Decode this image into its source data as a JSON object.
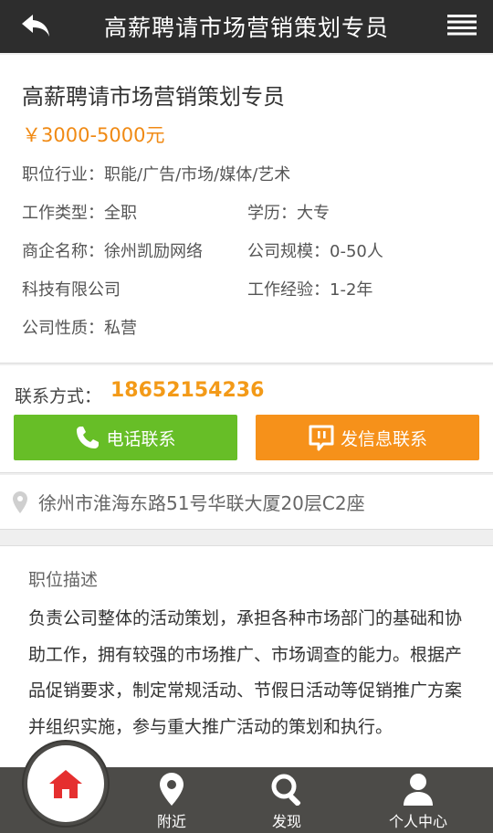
{
  "header": {
    "title": "高薪聘请市场营销策划专员",
    "back_icon": "back-arrow-icon",
    "menu_icon": "menu-icon"
  },
  "job": {
    "title": "高薪聘请市场营销策划专员",
    "salary": "￥3000-5000元",
    "industry": "职位行业：职能/广告/市场/媒体/艺术",
    "work_type": "工作类型：全职",
    "education": "学历：大专",
    "company_name_line1": "商企名称：徐州凯励网络",
    "company_name_line2": "科技有限公司",
    "company_size": "公司规模：0-50人",
    "experience": "工作经验：1-2年",
    "company_nature": "公司性质：私营"
  },
  "contact": {
    "label": "联系方式：",
    "phone": "18652154236",
    "call_button": "电话联系",
    "message_button": "发信息联系"
  },
  "address": {
    "text": "徐州市淮海东路51号华联大厦20层C2座"
  },
  "description": {
    "heading": "职位描述",
    "body": "负责公司整体的活动策划，承担各种市场部门的基础和协助工作，拥有较强的市场推广、市场调查的能力。根据产品促销要求，制定常规活动、节假日活动等促销推广方案并组织实施，参与重大推广活动的策划和执行。"
  },
  "bottom_nav": {
    "items": [
      {
        "label": "",
        "icon": "home-icon"
      },
      {
        "label": "附近",
        "icon": "location-pin-icon"
      },
      {
        "label": "发现",
        "icon": "search-icon"
      },
      {
        "label": "个人中心",
        "icon": "person-icon"
      }
    ]
  },
  "colors": {
    "header_bg": "#2d2d2d",
    "salary": "#f08a14",
    "phone": "#f39a18",
    "call_button": "#67be27",
    "message_button": "#f6911a",
    "nav_bg": "#4c4b48",
    "home_icon": "#e52f2f"
  }
}
